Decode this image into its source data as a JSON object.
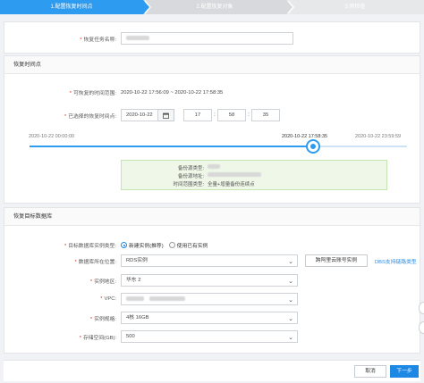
{
  "steps": [
    "1.配置恢复时间点",
    "2.配置恢复对象",
    "3.预检查"
  ],
  "task_name": {
    "label": "恢复任务名称:"
  },
  "section_time": {
    "title": "恢复时间点"
  },
  "restorable": {
    "label": "可恢复的时间范围:",
    "value": "2020-10-22 17:56:09 ~ 2020-10-22 17:58:35"
  },
  "selected_time": {
    "label": "已选择的恢复时间点:",
    "date": "2020-10-22",
    "hour": "17",
    "minute": "58",
    "second": "35",
    "separator": ":"
  },
  "slider": {
    "start_label": "2020-10-22 00:00:00",
    "current_label": "2020-10-22 17:58:35",
    "end_label": "2020-10-22 23:59:59",
    "position": 0.75
  },
  "backup_info": {
    "source_label": "备份源类型:",
    "address_label": "备份源地址:",
    "time_type_label": "时间范围类型:",
    "time_type_value": "全量+增量备份连续点"
  },
  "section_target": {
    "title": "恢复目标数据库"
  },
  "instance_type": {
    "label": "目标数据库实例类型:",
    "option_new": "新建实例(推荐)",
    "option_existing": "使用已有实例",
    "selected": "new"
  },
  "location": {
    "label": "数据库所在位置:",
    "value": "RDS实例",
    "cross_btn": "跨阿里云账号实例",
    "link": "DBS支持链路类型"
  },
  "region": {
    "label": "实例地区:",
    "value": "华东 2"
  },
  "vpc": {
    "label": "VPC:"
  },
  "spec": {
    "label": "实例规格:",
    "value": "4核 16GB"
  },
  "storage": {
    "label": "存储空间(GB):",
    "value": "500"
  },
  "footer": {
    "cancel": "取消",
    "next": "下一步"
  },
  "colors": {
    "primary": "#2d9cf0",
    "button": "#1e88e5",
    "required": "#e0312a",
    "info_bg": "#eef7e8"
  }
}
